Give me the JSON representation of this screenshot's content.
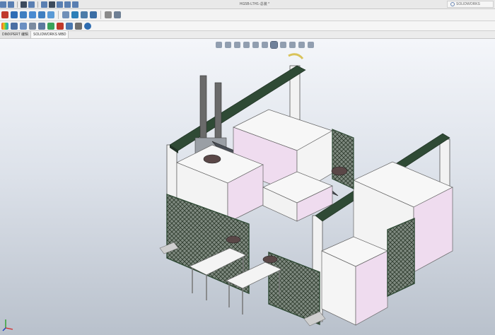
{
  "window": {
    "title": "HG5B-LTH1-总装 *",
    "search_placeholder": "SOLIDWORKS"
  },
  "tabs": [
    {
      "label": "DIMXPERT 编辑",
      "active": false
    },
    {
      "label": "SOLIDWORKS MBD",
      "active": true
    }
  ],
  "icons": {
    "quick_access": [
      "new-icon",
      "open-icon",
      "save-icon",
      "print-icon",
      "undo-icon",
      "select-icon",
      "rebuild-icon",
      "file-properties-icon",
      "options-icon"
    ],
    "toolbar": [
      "sketch-icon",
      "smart-dimension-icon",
      "line-icon",
      "rectangle-icon",
      "circle-icon",
      "arc-icon",
      "spline-icon",
      "trim-icon",
      "mirror-icon",
      "pattern-icon",
      "extrude-icon",
      "revolve-icon",
      "sweep-icon",
      "fillet-icon",
      "chamfer-icon",
      "shell-icon",
      "hole-icon",
      "reference-icon"
    ],
    "toolbar2": [
      "appearance-icon",
      "mates-icon",
      "component-pattern-icon",
      "assembly-feature-icon",
      "reference-geometry-icon",
      "new-motion-study-icon",
      "bill-of-materials-icon",
      "exploded-view-icon",
      "instant3d-icon",
      "section-icon",
      "display-states-icon",
      "options2-icon"
    ],
    "heads_up": [
      "zoom-to-fit-icon",
      "zoom-area-icon",
      "previous-view-icon",
      "section-view-icon",
      "dynamic-annotation-icon",
      "view-orientation-icon",
      "display-style-icon",
      "hide-show-icon",
      "edit-appearance-icon",
      "scene-icon",
      "view-settings-icon"
    ]
  },
  "colors": {
    "frame_green": "#2f4a35",
    "panel_pink": "#efdcef",
    "panel_white": "#f7f7f7",
    "mesh_dark": "#3d4a3a",
    "tool_dark": "#5a4747"
  }
}
